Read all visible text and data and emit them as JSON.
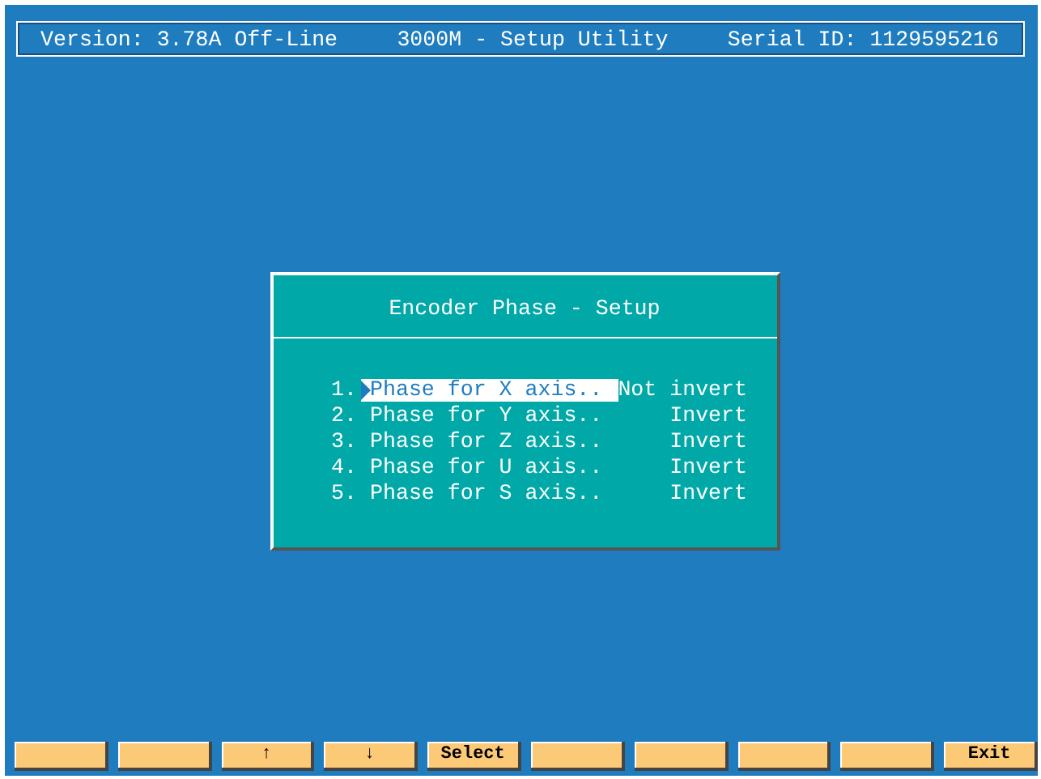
{
  "header": {
    "version": "Version: 3.78A Off-Line",
    "title": "3000M - Setup Utility",
    "serial": "Serial ID: 1129595216"
  },
  "dialog": {
    "title": "Encoder Phase - Setup",
    "items": [
      {
        "number": "1.",
        "label": "Phase for X axis..",
        "value": "Not invert",
        "selected": true
      },
      {
        "number": "2.",
        "label": "Phase for Y axis..",
        "value": "Invert",
        "selected": false
      },
      {
        "number": "3.",
        "label": "Phase for Z axis..",
        "value": "Invert",
        "selected": false
      },
      {
        "number": "4.",
        "label": "Phase for U axis..",
        "value": "Invert",
        "selected": false
      },
      {
        "number": "5.",
        "label": "Phase for S axis..",
        "value": "Invert",
        "selected": false
      }
    ]
  },
  "function_keys": [
    {
      "kind": "blank"
    },
    {
      "kind": "blank"
    },
    {
      "kind": "label",
      "label": "↑"
    },
    {
      "kind": "label",
      "label": "↓"
    },
    {
      "kind": "label",
      "label": "Select"
    },
    {
      "kind": "blank"
    },
    {
      "kind": "blank"
    },
    {
      "kind": "blank"
    },
    {
      "kind": "blank"
    },
    {
      "kind": "label",
      "label": "Exit"
    }
  ]
}
